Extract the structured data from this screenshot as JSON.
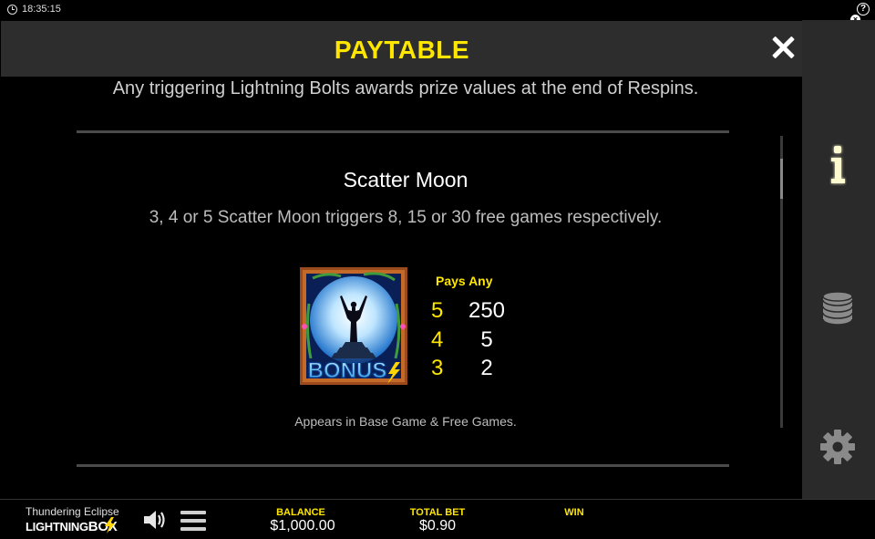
{
  "status_bar": {
    "time": "18:35:15"
  },
  "header": {
    "title": "PAYTABLE"
  },
  "content": {
    "respins_note": "Any triggering Lightning Bolts awards prize values at the end of Respins.",
    "section": {
      "title": "Scatter Moon",
      "description": "3, 4 or 5 Scatter Moon triggers 8, 15 or 30 free games respectively.",
      "symbol_text": "BONUS",
      "pays_heading": "Pays Any",
      "pays": [
        {
          "count": "5",
          "value": "250"
        },
        {
          "count": "4",
          "value": "5"
        },
        {
          "count": "3",
          "value": "2"
        }
      ],
      "appears": "Appears in Base Game & Free Games."
    }
  },
  "side_menu": {
    "icons": [
      "info-icon",
      "coins-icon",
      "gear-icon"
    ]
  },
  "footer": {
    "game_name": "Thundering Eclipse",
    "brand_part1": "LIGHTNING",
    "brand_part2": "BOX",
    "balance_label": "BALANCE",
    "balance_value": "$1,000.00",
    "total_bet_label": "TOTAL BET",
    "total_bet_value": "$0.90",
    "win_label": "WIN",
    "win_value": ""
  },
  "colors": {
    "accent": "#ffe600",
    "panel": "#2d2d2d",
    "background": "#000000"
  }
}
